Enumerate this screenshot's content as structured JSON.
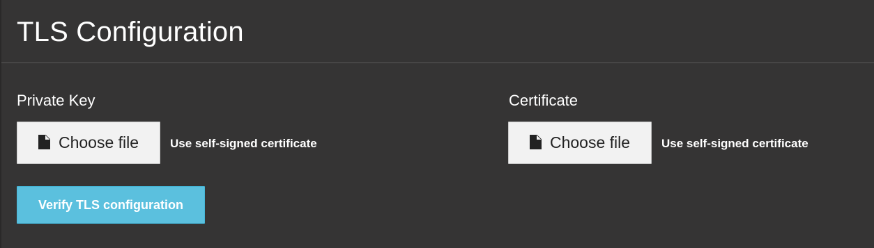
{
  "page": {
    "title": "TLS Configuration"
  },
  "private_key": {
    "label": "Private Key",
    "choose_file_label": "Choose file",
    "hint": "Use self-signed certificate",
    "icon": "file-icon"
  },
  "certificate": {
    "label": "Certificate",
    "choose_file_label": "Choose file",
    "hint": "Use self-signed certificate",
    "icon": "file-icon"
  },
  "actions": {
    "verify_label": "Verify TLS configuration"
  },
  "colors": {
    "background": "#353434",
    "button_bg": "#f2f2f2",
    "accent": "#5bc0de"
  }
}
